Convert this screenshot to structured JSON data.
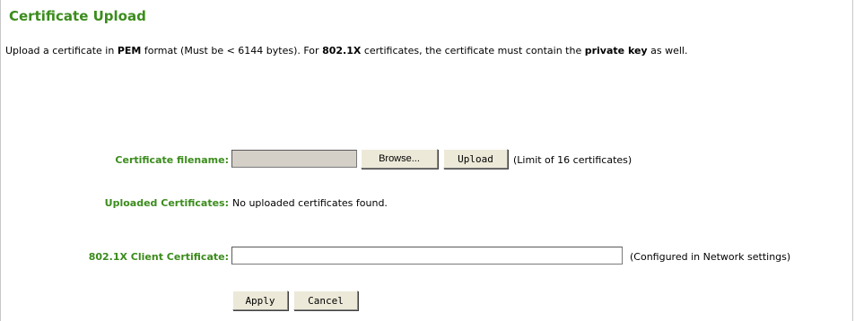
{
  "header": {
    "title": "Certificate Upload"
  },
  "description": {
    "part1": "Upload a certificate in ",
    "pem": "PEM",
    "part2": " format (Must be < 6144 bytes). For ",
    "dot1x": "802.1X",
    "part3": " certificates, the certificate must contain the ",
    "private_key": "private key",
    "part4": " as well."
  },
  "upload": {
    "label": "Certificate filename:",
    "browse_label": "Browse...",
    "upload_label": "Upload",
    "limit_note": "(Limit of 16 certificates)"
  },
  "uploaded": {
    "label": "Uploaded Certificates:",
    "value": "No uploaded certificates found."
  },
  "client_cert": {
    "label": "802.1X Client Certificate:",
    "value": "",
    "note": "(Configured in Network settings)"
  },
  "actions": {
    "apply_label": "Apply",
    "cancel_label": "Cancel"
  },
  "colors": {
    "accent": "#3b8c1c",
    "button_face": "#ece9d8",
    "disabled_field": "#d4d0c8"
  }
}
